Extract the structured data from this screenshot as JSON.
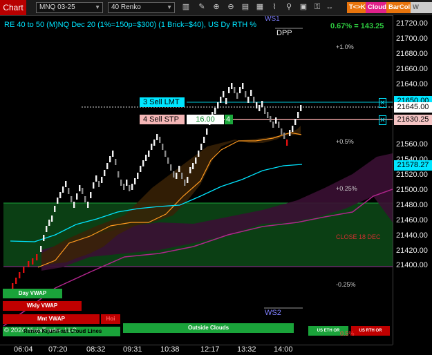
{
  "toolbar": {
    "title": "Chart",
    "instrument": "MNQ 03-25",
    "bar_type": "40 Renko",
    "icons": [
      "bars-icon",
      "pencil-icon",
      "zoom-in-icon",
      "zoom-out-icon",
      "properties-icon",
      "templates-icon",
      "indicators-icon",
      "strategies-icon",
      "drawing-tools-icon",
      "order-icon",
      "chart-trader-icon",
      "snapshot-icon",
      "lock-icon",
      "arrows-icon"
    ],
    "buttons": [
      {
        "label": "T<>K",
        "bg": "#e8740c"
      },
      {
        "label": "Cloud",
        "bg": "#e0218a"
      },
      {
        "label": "BarCol",
        "bg": "#e8740c"
      },
      {
        "label": "W VWA",
        "bg": "#cccccc"
      }
    ]
  },
  "header": {
    "text": "RE 40 to 50 (M)NQ Dec 20 (1%=150p=$300) (1 Brick=$40), US Dy RTH %",
    "pct": "0.67% = 143.25"
  },
  "levels": {
    "ws1": "WS1",
    "dpp": "DPP",
    "plus1": "+1.0%",
    "plus05": "+0.5%",
    "plus025": "+0.25%",
    "close": "CLOSE 18 DEC",
    "minus025": "-0.25%",
    "ws2": "WS2",
    "minus_tail": "0.5%"
  },
  "orders": {
    "sell_lmt": "3  Sell LMT",
    "sell_stp": "4  Sell STP",
    "qty_price": "16.00",
    "qty": "4"
  },
  "price_tags": {
    "upper_hidden": "21650.00",
    "last": "21645.00",
    "stop": "21630.25",
    "cyan": "21578.27"
  },
  "vwap_labels": {
    "day": "Day VWAP",
    "wkly": "Wkly VWAP",
    "mnt": "Mnt VWAP",
    "partial": "Hoi",
    "footer": "© 2024 NinjaTrader, LLC",
    "footer2": "Renko Kijun/Fast Cloud Lines",
    "outside": "Outside Clouds",
    "us_eth": "US ETH OR",
    "us_rth": "US RTH OR"
  },
  "y_axis": [
    "21720.00",
    "21700.00",
    "21680.00",
    "21660.00",
    "21640.00",
    "21620.00",
    "21600.00",
    "21580.00",
    "21560.00",
    "21540.00",
    "21520.00",
    "21500.00",
    "21480.00",
    "21460.00",
    "21440.00",
    "21420.00",
    "21400.00"
  ],
  "x_axis": [
    "06:04",
    "07:20",
    "08:32",
    "09:31",
    "10:38",
    "12:17",
    "13:32",
    "14:00"
  ],
  "colors": {
    "cyan": "#00e5ff",
    "orange": "#ff9a1f",
    "magenta": "#c0208f",
    "green_band": "#0c4a17",
    "red": "#c00000"
  }
}
